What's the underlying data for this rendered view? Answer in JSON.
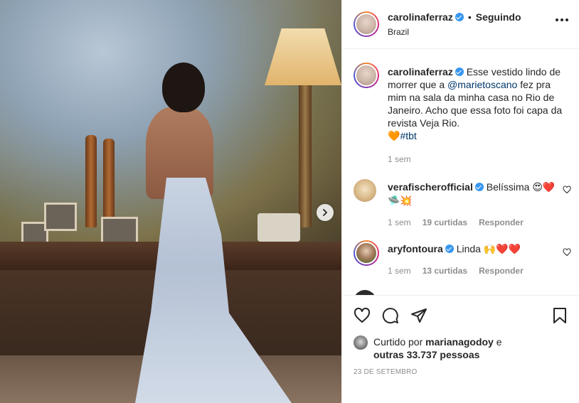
{
  "post": {
    "image_alt": "",
    "next_icon": "chevron-right-icon"
  },
  "header": {
    "username": "carolinaferraz",
    "separator": "•",
    "follow_status": "Seguindo",
    "location": "Brazil",
    "more_icon": "more-horizontal-icon"
  },
  "caption": {
    "username": "carolinaferraz",
    "text_before": "Esse vestido lindo de morrer que a",
    "mention": "@marietoscano",
    "text_after": "fez pra mim na sala da minha casa no Rio de Janeiro. Acho que essa foto foi capa da revista Veja Rio.",
    "emoji": "🧡",
    "hashtag": "#tbt",
    "time": "1 sem"
  },
  "comments": [
    {
      "username": "verafischerofficial",
      "text": "Belíssima",
      "emojis": "😍❤️",
      "emojis_line2": "🛸💥",
      "time": "1 sem",
      "likes": "19 curtidas",
      "reply": "Responder"
    },
    {
      "username": "aryfontoura",
      "text": "Linda",
      "emojis": "🙌❤️❤️",
      "time": "1 sem",
      "likes": "13 curtidas",
      "reply": "Responder"
    }
  ],
  "actions": {
    "like_icon": "heart-icon",
    "comment_icon": "comment-icon",
    "share_icon": "paper-plane-icon",
    "save_icon": "bookmark-icon"
  },
  "likes": {
    "prefix": "Curtido por",
    "liker": "marianagodoy",
    "connector": "e",
    "others": "outras 33.737 pessoas"
  },
  "date": "23 DE SETEMBRO",
  "colors": {
    "verified": "#3897f0",
    "link": "#00376b",
    "muted": "#8e8e8e",
    "heart_red": "#ed4956"
  }
}
